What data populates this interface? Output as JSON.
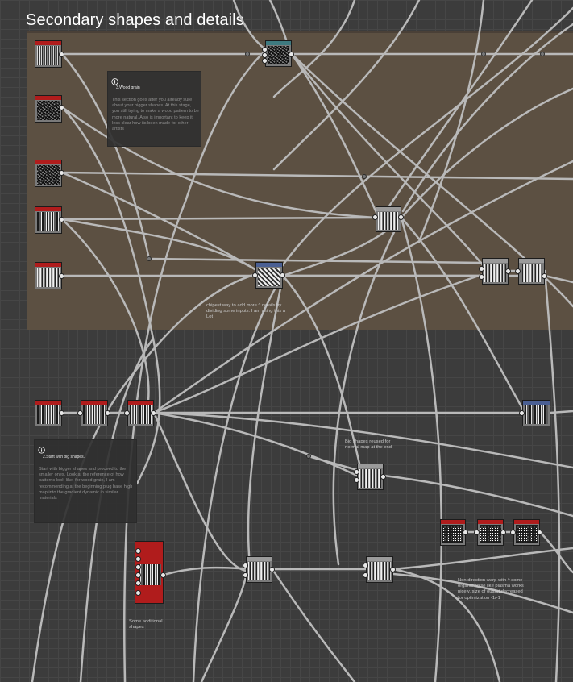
{
  "frame": {
    "title": "Secondary shapes and details",
    "color": "#5c5042"
  },
  "comments": [
    {
      "id": "wood-grain",
      "title": "3.Wood grain",
      "body": "This section goes after you already sure about your bigger shapes. At this stage, you still trying to make a wood pattern to be more natural. Also is important to keep it less clear how its been made for other artists"
    },
    {
      "id": "big-shapes",
      "title": "2.Start with big shapes.",
      "body": "Start with bigger shapes and proceed to the smaller ones. Look at the reference of how patterns look like, for wood grain, I am recommending at the beginning plug base high map into the gradient dynamic in similar materials"
    }
  ],
  "notes": {
    "cheapest": "chipest way to add more ^ details by dividing some inputs. I am using this a Lot",
    "big_reused": "Big shapes reused for normal map at the end",
    "warp": "Non direction warp with ^ some organic noise like plasma works nicely, size of output decreased for optimization -1/-1",
    "additional": "Some additional shapes"
  },
  "colors": {
    "node_header_red": "#b01c1c",
    "node_header_teal": "#3e7a80",
    "node_header_blue": "#4a5f93",
    "wire": "#b9b9b9"
  },
  "nodes": [
    {
      "name": "node-grunge-1",
      "type": "red"
    },
    {
      "name": "node-grunge-2",
      "type": "red"
    },
    {
      "name": "node-grunge-3",
      "type": "red"
    },
    {
      "name": "node-grunge-4",
      "type": "red"
    },
    {
      "name": "node-grunge-5",
      "type": "red"
    },
    {
      "name": "node-teal",
      "type": "teal"
    },
    {
      "name": "node-blend-a",
      "type": "grey"
    },
    {
      "name": "node-blue-chain",
      "type": "blue"
    },
    {
      "name": "node-blend-b",
      "type": "grey"
    },
    {
      "name": "node-blend-c",
      "type": "grey"
    },
    {
      "name": "node-stripes-1",
      "type": "red"
    },
    {
      "name": "node-stripes-2",
      "type": "red"
    },
    {
      "name": "node-stripes-3",
      "type": "red"
    },
    {
      "name": "node-blue-right",
      "type": "blue"
    },
    {
      "name": "node-reuse",
      "type": "grey"
    },
    {
      "name": "node-noise-1",
      "type": "red"
    },
    {
      "name": "node-noise-2",
      "type": "red"
    },
    {
      "name": "node-noise-3",
      "type": "red"
    },
    {
      "name": "node-additional",
      "type": "red"
    },
    {
      "name": "node-blend-d",
      "type": "grey"
    },
    {
      "name": "node-warp",
      "type": "grey"
    }
  ]
}
